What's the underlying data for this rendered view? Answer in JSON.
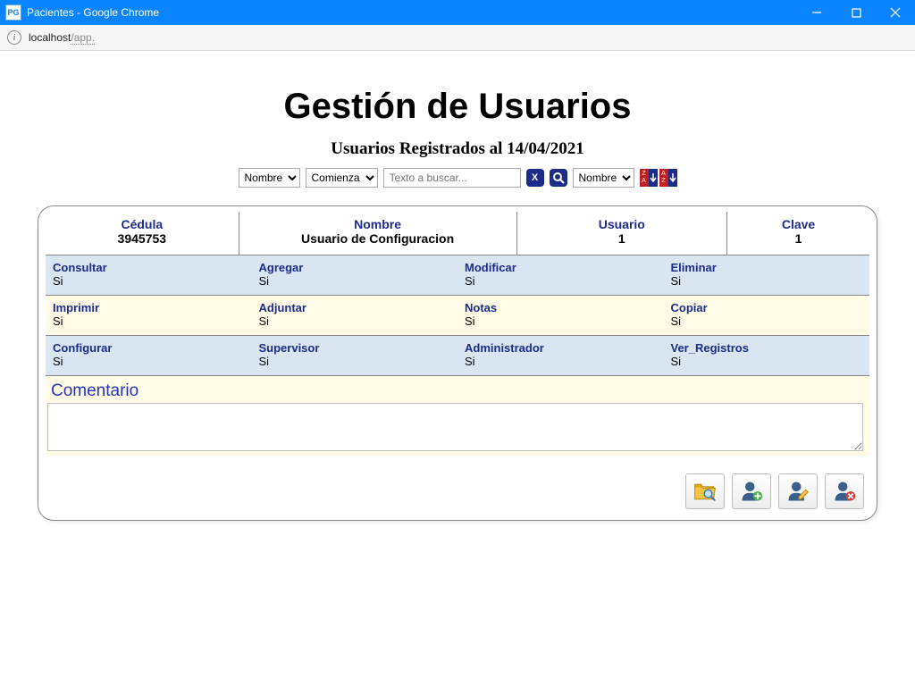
{
  "window": {
    "title": "Pacientes - Google Chrome",
    "app_icon": "PG"
  },
  "url": {
    "host": "localhost",
    "path": "/app."
  },
  "page": {
    "title": "Gestión de Usuarios",
    "subtitle": "Usuarios Registrados al 14/04/2021"
  },
  "search": {
    "field_select": "Nombre",
    "match_select": "Comienza",
    "placeholder": "Texto a buscar...",
    "sort_field_select": "Nombre",
    "clear_label": "X",
    "sort_desc_letters_top": "Z",
    "sort_desc_letters_bot": "A",
    "sort_asc_letters_top": "A",
    "sort_asc_letters_bot": "Z"
  },
  "user": {
    "header": [
      {
        "label": "Cédula",
        "value": "3945753"
      },
      {
        "label": "Nombre",
        "value": "Usuario de Configuracion"
      },
      {
        "label": "Usuario",
        "value": "1"
      },
      {
        "label": "Clave",
        "value": "1"
      }
    ],
    "perm_rows": [
      {
        "cls": "blue",
        "cells": [
          {
            "label": "Consultar",
            "value": "Si"
          },
          {
            "label": "Agregar",
            "value": "Si"
          },
          {
            "label": "Modificar",
            "value": "Si"
          },
          {
            "label": "Eliminar",
            "value": "Si"
          }
        ]
      },
      {
        "cls": "yellow",
        "cells": [
          {
            "label": "Imprimir",
            "value": "Si"
          },
          {
            "label": "Adjuntar",
            "value": "Si"
          },
          {
            "label": "Notas",
            "value": "Si"
          },
          {
            "label": "Copiar",
            "value": "Si"
          }
        ]
      },
      {
        "cls": "blue",
        "cells": [
          {
            "label": "Configurar",
            "value": "Si"
          },
          {
            "label": "Supervisor",
            "value": "Si"
          },
          {
            "label": "Administrador",
            "value": "Si"
          },
          {
            "label": "Ver_Registros",
            "value": "Si"
          }
        ]
      }
    ],
    "comment_label": "Comentario",
    "comment_value": ""
  }
}
